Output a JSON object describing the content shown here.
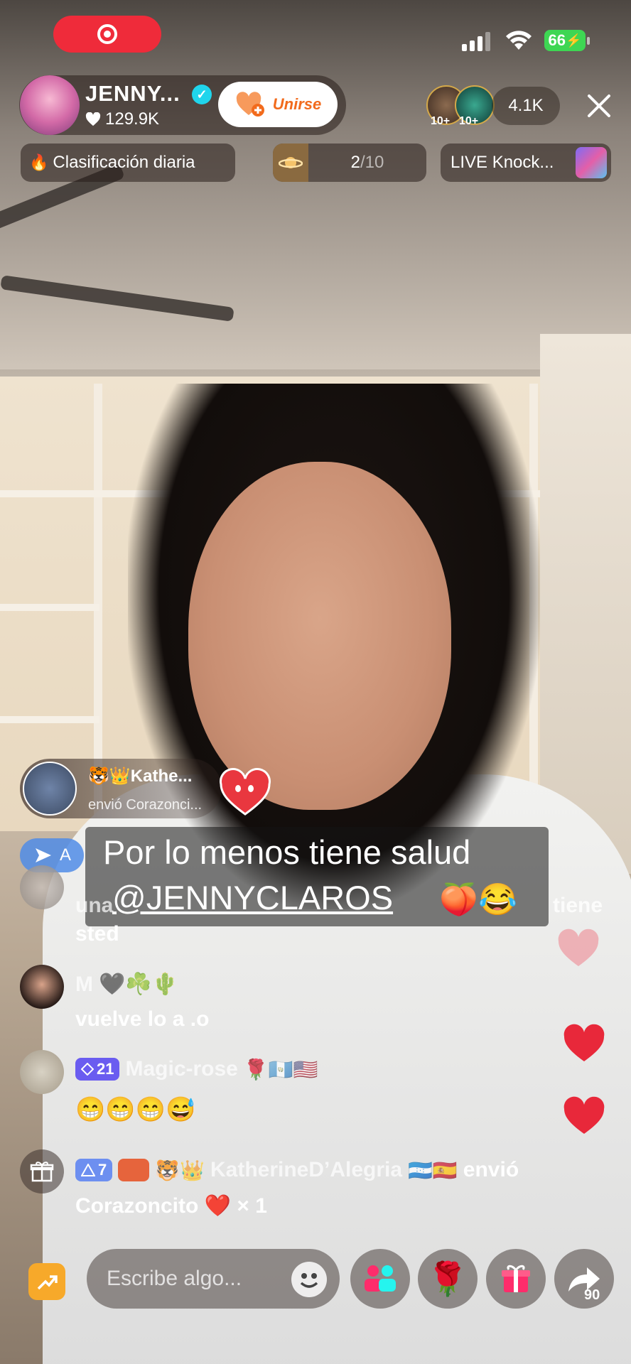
{
  "status_bar": {
    "battery": "66"
  },
  "host": {
    "name": "JENNY...",
    "likes": "129.9K",
    "join_label": "Unirse"
  },
  "viewers": {
    "badge_1": "10+",
    "badge_2": "10+",
    "count": "4.1K"
  },
  "chips": {
    "daily_ranking": "Clasificación diaria",
    "rank_current": "2",
    "rank_total": "/10",
    "knockout": "LIVE Knock..."
  },
  "gift_banner": {
    "user": "Kathe...",
    "action": "envió Corazonci..."
  },
  "notice": {
    "letter": "A"
  },
  "caption": {
    "line1": "Por lo menos tiene salud",
    "line2": "@JENNYCLAROS"
  },
  "comments": [
    {
      "name": "",
      "text_part1": "una",
      "text_part2": "tiene",
      "text_line2": "sted"
    },
    {
      "name": "M",
      "text": "vuelve lo a .o"
    },
    {
      "level": "21",
      "name": "Magic-rose",
      "text": "😁😁😁😅"
    },
    {
      "level": "7",
      "name": "KatherineD’Alegria",
      "action": "envió",
      "gift": "Corazoncito",
      "multiplier": "× 1"
    }
  ],
  "bottom_bar": {
    "input_placeholder": "Escribe algo...",
    "share_count": "90"
  },
  "colors": {
    "record": "#ef2b3a",
    "battery": "#3ed653",
    "verified": "#20d5ec",
    "join_text": "#f26b1d",
    "level_badge": "#6a5cf0",
    "heart": "#e8283a"
  }
}
